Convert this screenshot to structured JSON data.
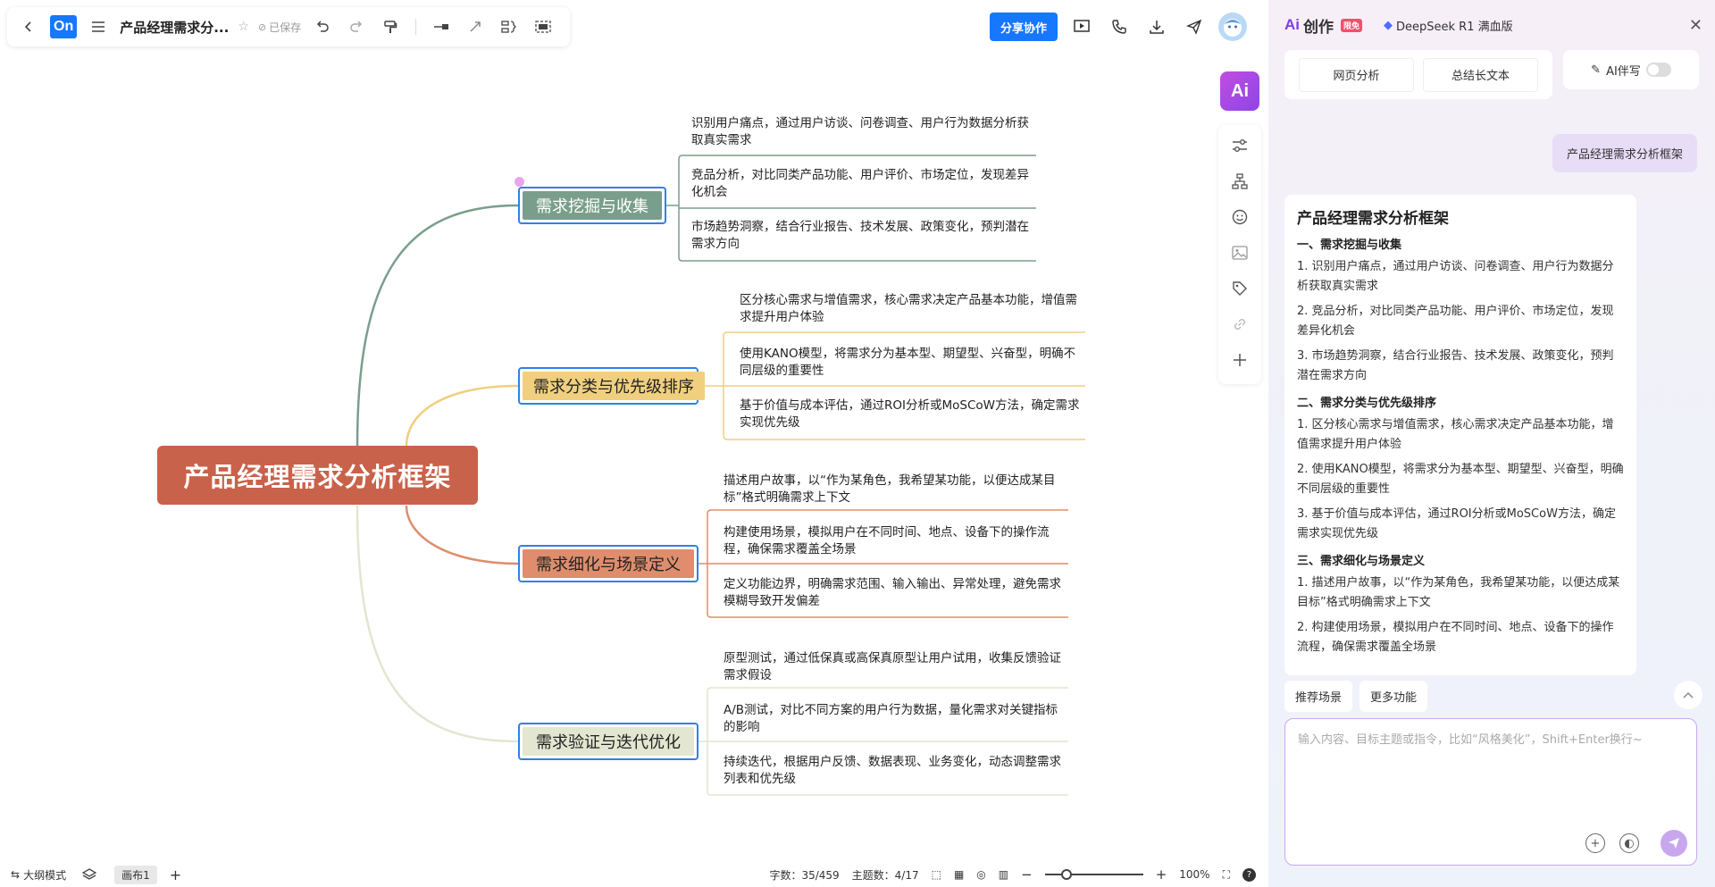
{
  "toolbar": {
    "logo": "On",
    "doc_title": "产品经理需求分...",
    "saved": "已保存",
    "share": "分享协作"
  },
  "mindmap": {
    "root": "产品经理需求分析框架",
    "branches": [
      {
        "label": "需求挖掘与收集",
        "color": "#7a9e8c",
        "leaves": [
          "识别用户痛点，通过用户访谈、问卷调查、用户行为数据分析获取真实需求",
          "竞品分析，对比同类产品功能、用户评价、市场定位，发现差异化机会",
          "市场趋势洞察，结合行业报告、技术发展、政策变化，预判潜在需求方向"
        ]
      },
      {
        "label": "需求分类与优先级排序",
        "color": "#f0cf7e",
        "leaves": [
          "区分核心需求与增值需求，核心需求决定产品基本功能，增值需求提升用户体验",
          "使用KANO模型，将需求分为基本型、期望型、兴奋型，明确不同层级的重要性",
          "基于价值与成本评估，通过ROI分析或MoSCoW方法，确定需求实现优先级"
        ]
      },
      {
        "label": "需求细化与场景定义",
        "color": "#df8d6d",
        "leaves": [
          "描述用户故事，以“作为某角色，我希望某功能，以便达成某目标”格式明确需求上下文",
          "构建使用场景，模拟用户在不同时间、地点、设备下的操作流程，确保需求覆盖全场景",
          "定义功能边界，明确需求范围、输入输出、异常处理，避免需求模糊导致开发偏差"
        ]
      },
      {
        "label": "需求验证与迭代优化",
        "color": "#e3e6d0",
        "leaves": [
          "原型测试，通过低保真或高保真原型让用户试用，收集反馈验证需求假设",
          "A/B测试，对比不同方案的用户行为数据，量化需求对关键指标的影响",
          "持续迭代，根据用户反馈、数据表现、业务变化，动态调整需求列表和优先级"
        ]
      }
    ]
  },
  "side_tools": [
    "sliders-icon",
    "org-chart-icon",
    "emoji-icon",
    "image-icon",
    "tag-icon",
    "link-icon",
    "plus-icon"
  ],
  "statusbar": {
    "outline_mode": "大纲模式",
    "canvas_tab": "画布1",
    "word_count": "字数：35/459",
    "topic_count": "主题数：4/17",
    "zoom": "100%"
  },
  "ai_panel": {
    "brand": "创作",
    "brand_prefix": "Ai",
    "free_badge": "限免",
    "model": "DeepSeek R1 满血版",
    "quick_actions": [
      "网页分析",
      "总结长文本"
    ],
    "ai_write": "AI伴写",
    "user_message": "产品经理需求分析框架",
    "answer": {
      "title": "产品经理需求分析框架",
      "sections": [
        {
          "heading": "一、需求挖掘与收集",
          "items": [
            "1. 识别用户痛点，通过用户访谈、问卷调查、用户行为数据分析获取真实需求",
            "2. 竞品分析，对比同类产品功能、用户评价、市场定位，发现差异化机会",
            "3. 市场趋势洞察，结合行业报告、技术发展、政策变化，预判潜在需求方向"
          ]
        },
        {
          "heading": "二、需求分类与优先级排序",
          "items": [
            "1. 区分核心需求与增值需求，核心需求决定产品基本功能，增值需求提升用户体验",
            "2. 使用KANO模型，将需求分为基本型、期望型、兴奋型，明确不同层级的重要性",
            "3. 基于价值与成本评估，通过ROI分析或MoSCoW方法，确定需求实现优先级"
          ]
        },
        {
          "heading": "三、需求细化与场景定义",
          "items": [
            "1. 描述用户故事，以“作为某角色，我希望某功能，以便达成某目标”格式明确需求上下文",
            "2. 构建使用场景，模拟用户在不同时间、地点、设备下的操作流程，确保需求覆盖全场景"
          ]
        }
      ]
    },
    "chips": [
      "推荐场景",
      "更多功能"
    ],
    "input_placeholder": "输入内容、目标主题或指令，比如“风格美化”，Shift+Enter换行~"
  }
}
